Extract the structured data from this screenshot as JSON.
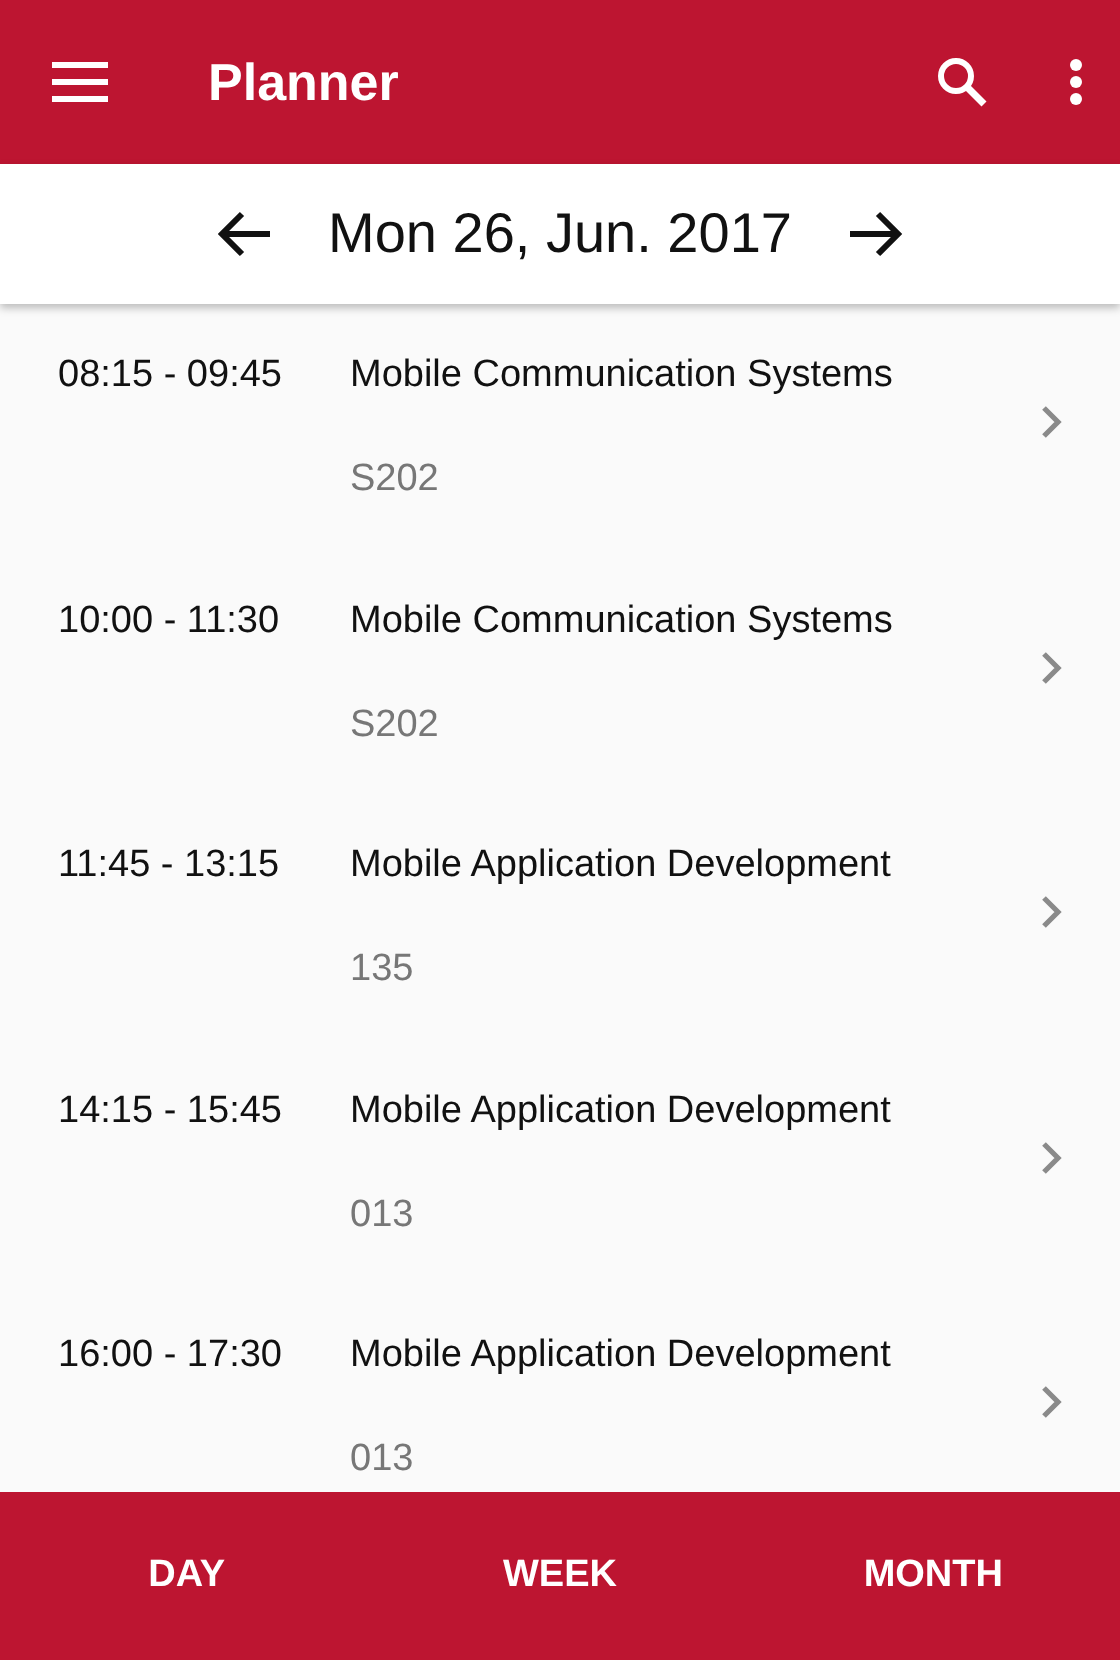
{
  "app_bar": {
    "title": "Planner"
  },
  "date_bar": {
    "date": "Mon 26, Jun. 2017"
  },
  "events": [
    {
      "time": "08:15 - 09:45",
      "title": "Mobile Communication Systems",
      "room": "S202"
    },
    {
      "time": "10:00 - 11:30",
      "title": "Mobile Communication Systems",
      "room": "S202"
    },
    {
      "time": "11:45 - 13:15",
      "title": "Mobile Application Development",
      "room": "135"
    },
    {
      "time": "14:15 - 15:45",
      "title": "Mobile Application Development",
      "room": "013"
    },
    {
      "time": "16:00 - 17:30",
      "title": "Mobile Application Development",
      "room": "013"
    }
  ],
  "bottom_tabs": [
    "DAY",
    "WEEK",
    "MONTH"
  ]
}
